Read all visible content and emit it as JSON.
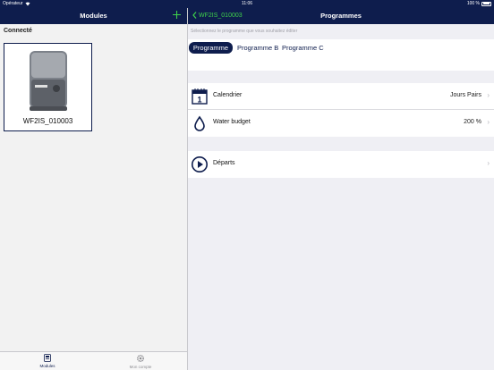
{
  "status_bar": {
    "carrier": "Opérateur",
    "time": "11:06",
    "battery": "100 %"
  },
  "left_nav": {
    "title": "Modules"
  },
  "right_nav": {
    "back_label": "WF2IS_010003",
    "title": "Programmes"
  },
  "left_panel": {
    "section_title": "Connecté",
    "devices": [
      {
        "name": "WF2IS_010003",
        "icon": "irrigation-controller"
      }
    ]
  },
  "tab_bar": {
    "tabs": [
      {
        "label": "Modules",
        "icon": "module-icon",
        "active": true
      },
      {
        "label": "Mon compte",
        "icon": "gear-icon",
        "active": false
      }
    ]
  },
  "right_panel": {
    "hint": "Sélectionnez le programme que vous souhaitez éditer",
    "programs": [
      "Programme A",
      "Programme B",
      "Programme C"
    ],
    "selected_program": "Programme A",
    "rows": [
      {
        "label": "Calendrier",
        "value": "Jours Pairs",
        "icon": "calendar-icon",
        "icon_text": "1"
      },
      {
        "label": "Water budget",
        "value": "200 %",
        "icon": "water-drop-icon"
      },
      {
        "label": "Départs",
        "value": "",
        "icon": "play-icon"
      }
    ]
  },
  "colors": {
    "navbar": "#0e1d4d",
    "accent_green": "#3fd14b",
    "background": "#efeff4"
  }
}
